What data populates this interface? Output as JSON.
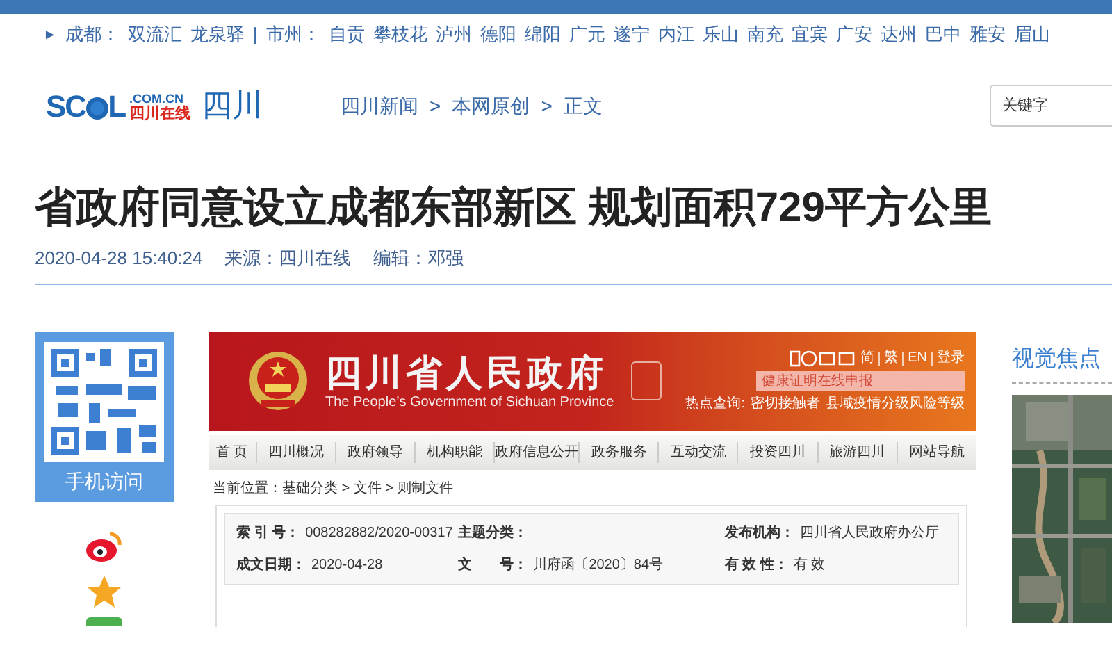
{
  "city_bar": {
    "marker": "►",
    "groups": [
      {
        "label": "成都：",
        "links": [
          "双流汇",
          "龙泉驿"
        ]
      },
      {
        "label": "市州：",
        "links": [
          "自贡",
          "攀枝花",
          "泸州",
          "德阳",
          "绵阳",
          "广元",
          "遂宁",
          "内江",
          "乐山",
          "南充",
          "宜宾",
          "广安",
          "达州",
          "巴中",
          "雅安",
          "眉山"
        ]
      }
    ],
    "separator": "|"
  },
  "header": {
    "logo": {
      "letters": "SC",
      "letters_after": "L",
      "domain": ".COM.CN",
      "name": "四川在线"
    },
    "channel": "四川",
    "breadcrumb": [
      "四川新闻",
      "本网原创",
      "正文"
    ],
    "breadcrumb_separator": ">",
    "search": {
      "placeholder": "关键字"
    }
  },
  "article": {
    "title": "省政府同意设立成都东部新区 规划面积729平方公里",
    "time": "2020-04-28 15:40:24",
    "source": "来源：四川在线",
    "editor": "编辑：邓强"
  },
  "share": {
    "qr_caption": "手机访问"
  },
  "embedded_page": {
    "site_title": "四川省人民政府",
    "site_subtitle": "The People’s Government of Sichuan Province",
    "lang_links": [
      "简",
      "繁",
      "EN",
      "登录"
    ],
    "search_placeholder": "健康证明在线申报",
    "hot_label": "热点查询:",
    "hot_links": [
      "密切接触者",
      "县域疫情分级风险等级"
    ],
    "nav": [
      {
        "label": "首 页"
      },
      {
        "label": "四川概况"
      },
      {
        "label": "政府领导"
      },
      {
        "label": "机构职能"
      },
      {
        "label": "政府信息公开"
      },
      {
        "label": "政务服务"
      },
      {
        "label": "互动交流"
      },
      {
        "label": "投资四川"
      },
      {
        "label": "旅游四川"
      },
      {
        "label": "网站导航"
      }
    ],
    "location": "当前位置：基础分类 > 文件 > 则制文件",
    "info_rows": [
      [
        {
          "label": "索 引 号：",
          "value": "008282882/2020-00317"
        },
        {
          "label": "主题分类："
        },
        {
          "label": "发布机构：",
          "value": "四川省人民政府办公厅"
        }
      ],
      [
        {
          "label": "成文日期：",
          "value": "2020-04-28"
        },
        {
          "label": "文　　号：",
          "value": "川府函〔2020〕84号"
        },
        {
          "label": "有 效 性：",
          "value": "有 效"
        }
      ]
    ]
  },
  "sidebar": {
    "heading": "视觉焦点"
  }
}
